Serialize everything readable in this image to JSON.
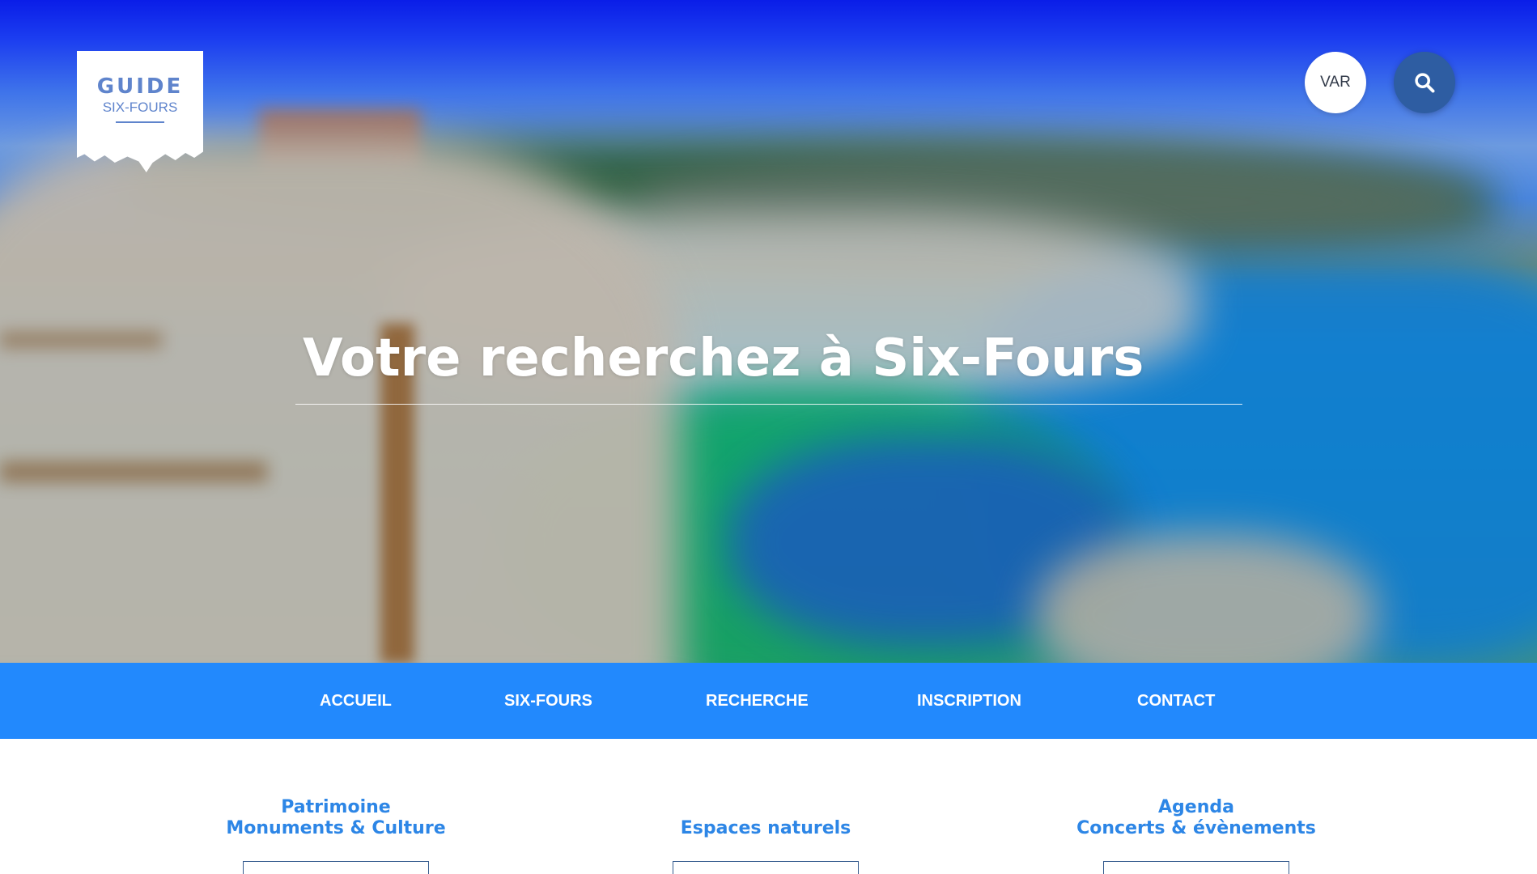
{
  "logo": {
    "top": "GUIDE",
    "bottom": "SIX-FOURS"
  },
  "header": {
    "var_label": "VAR",
    "search_icon": "search-icon"
  },
  "hero": {
    "title": "Votre recherchez à Six-Fours"
  },
  "nav": {
    "items": [
      "ACCUEIL",
      "SIX-FOURS",
      "RECHERCHE",
      "INSCRIPTION",
      "CONTACT"
    ]
  },
  "categories": [
    {
      "line1": "Patrimoine",
      "line2": "Monuments & Culture"
    },
    {
      "line1": "",
      "line2": "Espaces naturels"
    },
    {
      "line1": "Agenda",
      "line2": "Concerts & évènements"
    }
  ],
  "colors": {
    "nav_bg": "#2289fd",
    "category_text": "#2d86e6",
    "search_button": "#2e5da2",
    "logo": "#5f84cc"
  }
}
